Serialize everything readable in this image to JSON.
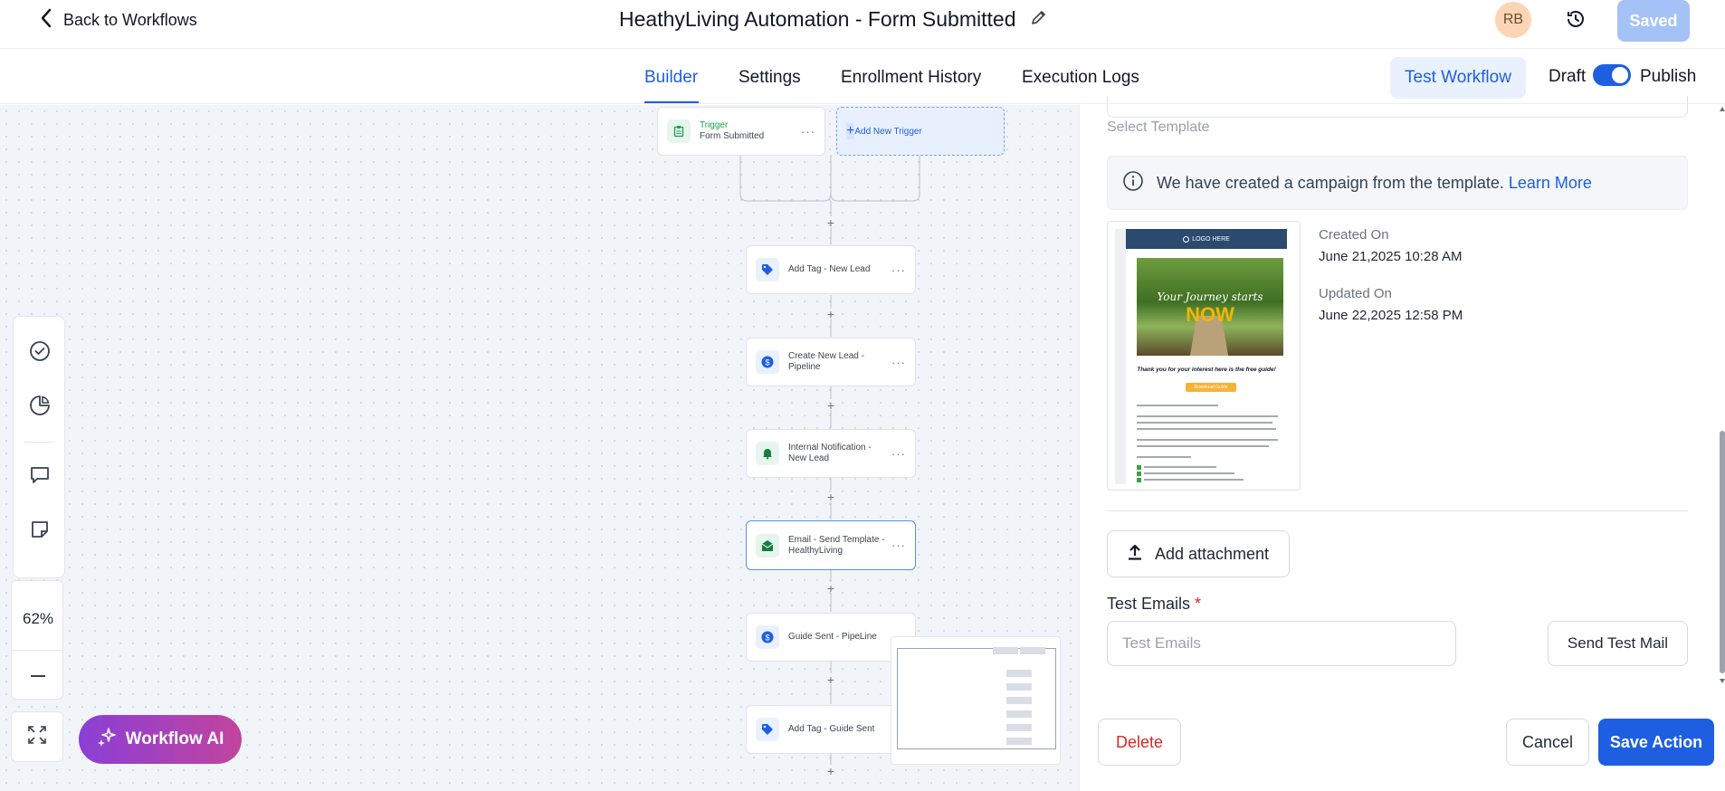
{
  "header": {
    "back_label": "Back to Workflows",
    "workflow_title": "HeathyLiving Automation - Form Submitted",
    "avatar_initials": "RB",
    "saved_label": "Saved"
  },
  "tabs": [
    {
      "label": "Builder",
      "active": true
    },
    {
      "label": "Settings",
      "active": false
    },
    {
      "label": "Enrollment History",
      "active": false
    },
    {
      "label": "Execution Logs",
      "active": false
    }
  ],
  "actions": {
    "test_workflow_label": "Test Workflow",
    "draft_label": "Draft",
    "publish_label": "Publish",
    "published": true
  },
  "canvas": {
    "trigger": {
      "type_label": "Trigger",
      "name": "Form Submitted"
    },
    "add_trigger_label": "Add New Trigger",
    "nodes": [
      {
        "label": "Add Tag - New Lead",
        "icon": "tag-icon"
      },
      {
        "label": "Create New Lead - Pipeline",
        "icon": "dollar-icon"
      },
      {
        "label": "Internal Notification - New Lead",
        "icon": "bell-icon"
      },
      {
        "label": "Email - Send Template - HealthyLiving",
        "icon": "email-icon",
        "selected": true
      },
      {
        "label": "Guide Sent - PipeLine",
        "icon": "dollar-icon"
      },
      {
        "label": "Add Tag - Guide Sent",
        "icon": "tag-icon"
      }
    ],
    "zoom": "62%",
    "workflow_ai_label": "Workflow AI"
  },
  "panel": {
    "select_template_label": "Select Template",
    "info_text": "We have created a campaign from the template.",
    "info_link": "Learn More",
    "template_preview": {
      "logo_text": "LOGO HERE",
      "hero_script": "Your Journey starts",
      "hero_big": "NOW",
      "thanks_text": "Thank you for your interest here is the free guide!",
      "button_text": "Download Guide"
    },
    "created_on_label": "Created On",
    "created_on_value": "June 21,2025 10:28 AM",
    "updated_on_label": "Updated On",
    "updated_on_value": "June 22,2025 12:58 PM",
    "add_attachment_label": "Add attachment",
    "test_emails_label": "Test Emails",
    "test_emails_required": "*",
    "test_emails_placeholder": "Test Emails",
    "send_test_mail_label": "Send Test Mail",
    "delete_label": "Delete",
    "cancel_label": "Cancel",
    "save_action_label": "Save Action"
  },
  "colors": {
    "accent": "#1d5fe0",
    "danger": "#dc2626",
    "canvas_bg": "#f1f4f8"
  }
}
